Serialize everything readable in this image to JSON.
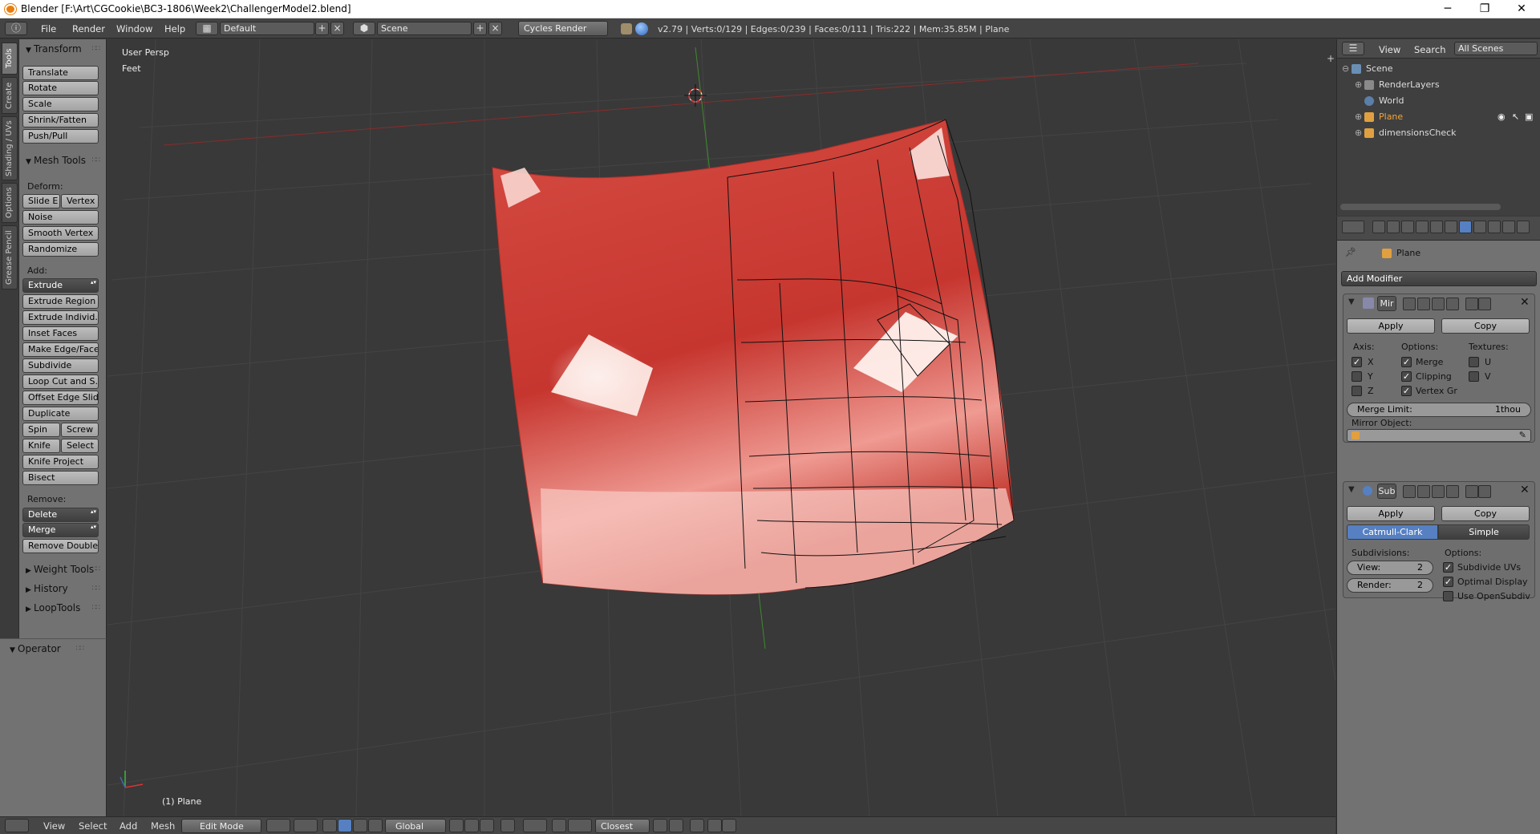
{
  "window": {
    "title": "Blender [F:\\Art\\CGCookie\\BC3-1806\\Week2\\ChallengerModel2.blend]",
    "minimize": "─",
    "maximize": "❐",
    "close": "✕"
  },
  "info_header": {
    "menus": [
      "File",
      "Render",
      "Window",
      "Help"
    ],
    "screen_layout": "Default",
    "scene": "Scene",
    "render_engine": "Cycles Render",
    "stats": "v2.79 | Verts:0/129 | Edges:0/239 | Faces:0/111 | Tris:222 | Mem:35.85M | Plane"
  },
  "tool_tabs": [
    "Tools",
    "Create",
    "Shading / UVs",
    "Options",
    "Grease Pencil"
  ],
  "toolshelf": {
    "transform": {
      "title": "Transform",
      "buttons": [
        "Translate",
        "Rotate",
        "Scale",
        "Shrink/Fatten",
        "Push/Pull"
      ]
    },
    "mesh_tools": {
      "title": "Mesh Tools",
      "deform_label": "Deform:",
      "slide_edge": "Slide E",
      "vertex": "Vertex",
      "deform_buttons": [
        "Noise",
        "Smooth Vertex",
        "Randomize"
      ],
      "add_label": "Add:",
      "extrude": "Extrude",
      "add_buttons": [
        "Extrude Region",
        "Extrude Individ...",
        "Inset Faces",
        "Make Edge/Face",
        "Subdivide",
        "Loop Cut and S...",
        "Offset Edge Slide",
        "Duplicate"
      ],
      "spin": "Spin",
      "screw": "Screw",
      "knife": "Knife",
      "select": "Select",
      "knife_project": "Knife Project",
      "bisect": "Bisect",
      "remove_label": "Remove:",
      "delete": "Delete",
      "merge": "Merge",
      "remove_doubles": "Remove Doubles"
    },
    "collapsed_panels": [
      "Weight Tools",
      "History",
      "LoopTools"
    ],
    "operator": "Operator"
  },
  "viewport": {
    "view_name": "User Persp",
    "units": "Feet",
    "active_object": "(1) Plane"
  },
  "view3d_header": {
    "menus": [
      "View",
      "Select",
      "Add",
      "Mesh"
    ],
    "mode": "Edit Mode",
    "orientation": "Global",
    "snap_target": "Closest"
  },
  "outliner": {
    "menus": [
      "View",
      "Search"
    ],
    "filter": "All Scenes",
    "rows": [
      {
        "label": "Scene",
        "indent": 0
      },
      {
        "label": "RenderLayers",
        "indent": 1
      },
      {
        "label": "World",
        "indent": 1
      },
      {
        "label": "Plane",
        "indent": 1,
        "selected": true
      },
      {
        "label": "dimensionsCheck",
        "indent": 1
      }
    ]
  },
  "properties": {
    "object_name": "Plane",
    "add_modifier": "Add Modifier",
    "mirror": {
      "name": "Mir",
      "apply": "Apply",
      "copy": "Copy",
      "axis_label": "Axis:",
      "options_label": "Options:",
      "textures_label": "Textures:",
      "axes": [
        {
          "label": "X",
          "checked": true
        },
        {
          "label": "Y",
          "checked": false
        },
        {
          "label": "Z",
          "checked": false
        }
      ],
      "options": [
        {
          "label": "Merge",
          "checked": true
        },
        {
          "label": "Clipping",
          "checked": true
        },
        {
          "label": "Vertex Gr",
          "checked": true
        }
      ],
      "textures": [
        {
          "label": "U",
          "checked": false
        },
        {
          "label": "V",
          "checked": false
        }
      ],
      "merge_limit_label": "Merge Limit:",
      "merge_limit_value": "1thou",
      "mirror_object_label": "Mirror Object:"
    },
    "subsurf": {
      "name": "Sub",
      "apply": "Apply",
      "copy": "Copy",
      "catmull": "Catmull-Clark",
      "simple": "Simple",
      "subdivisions_label": "Subdivisions:",
      "options_label": "Options:",
      "view_label": "View:",
      "view_value": "2",
      "render_label": "Render:",
      "render_value": "2",
      "options": [
        {
          "label": "Subdivide UVs",
          "checked": true
        },
        {
          "label": "Optimal Display",
          "checked": true
        },
        {
          "label": "Use OpenSubdiv",
          "checked": false
        }
      ]
    }
  },
  "colors": {
    "mesh_red": "#c8403a",
    "highlight": "#fff2ee",
    "selected_text": "#f2a43a",
    "accent_blue": "#5680c2"
  }
}
